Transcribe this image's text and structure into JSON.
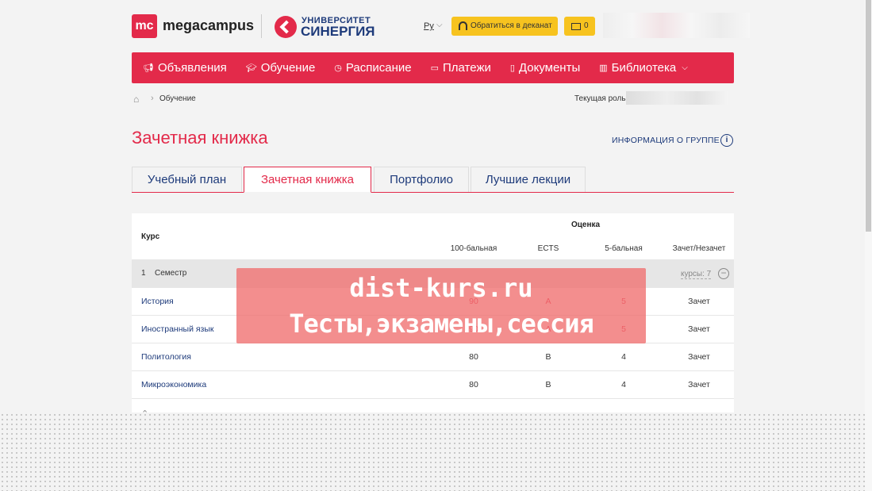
{
  "header": {
    "logo_mark": "mc",
    "logo_text": "megacampus",
    "university_top": "УНИВЕРСИТЕТ",
    "university_name": "СИНЕРГИЯ",
    "language": "Ру",
    "dean_button": "Обратиться в деканат",
    "mail_count": "0"
  },
  "nav": {
    "items": [
      {
        "label": "Объявления",
        "icon": "megaphone-icon"
      },
      {
        "label": "Обучение",
        "icon": "graduation-cap-icon"
      },
      {
        "label": "Расписание",
        "icon": "clock-icon"
      },
      {
        "label": "Платежи",
        "icon": "card-icon"
      },
      {
        "label": "Документы",
        "icon": "document-icon"
      },
      {
        "label": "Библиотека",
        "icon": "book-icon"
      }
    ]
  },
  "breadcrumb": {
    "current": "Обучение",
    "role_label": "Текущая роль:"
  },
  "page": {
    "title": "Зачетная книжка",
    "group_info": "ИНФОРМАЦИЯ О ГРУППЕ"
  },
  "tabs": [
    {
      "label": "Учебный план",
      "active": false
    },
    {
      "label": "Зачетная книжка",
      "active": true
    },
    {
      "label": "Портфолио",
      "active": false
    },
    {
      "label": "Лучшие лекции",
      "active": false
    }
  ],
  "table": {
    "col_course": "Курс",
    "col_grade": "Оценка",
    "sub_cols": [
      "100-бальная",
      "ECTS",
      "5-бальная",
      "Зачет/Незачет"
    ],
    "semester": {
      "number": "1",
      "name": "Семестр",
      "courses": "курсы: 7"
    },
    "rows": [
      {
        "name": "История",
        "score100": "90",
        "ects": "A",
        "score5": "5",
        "pass": "Зачет"
      },
      {
        "name": "Иностранный язык",
        "score100": "90",
        "ects": "A",
        "score5": "5",
        "pass": "Зачет"
      },
      {
        "name": "Политология",
        "score100": "80",
        "ects": "B",
        "score5": "4",
        "pass": "Зачет"
      },
      {
        "name": "Микроэкономика",
        "score100": "80",
        "ects": "B",
        "score5": "4",
        "pass": "Зачет"
      }
    ]
  },
  "watermark": {
    "line1": "dist-kurs.ru",
    "line2": "Тесты,экзамены,сессия"
  },
  "colors": {
    "brand": "#e32a4a",
    "link": "#1d3a7a",
    "accent": "#f7c31f"
  }
}
